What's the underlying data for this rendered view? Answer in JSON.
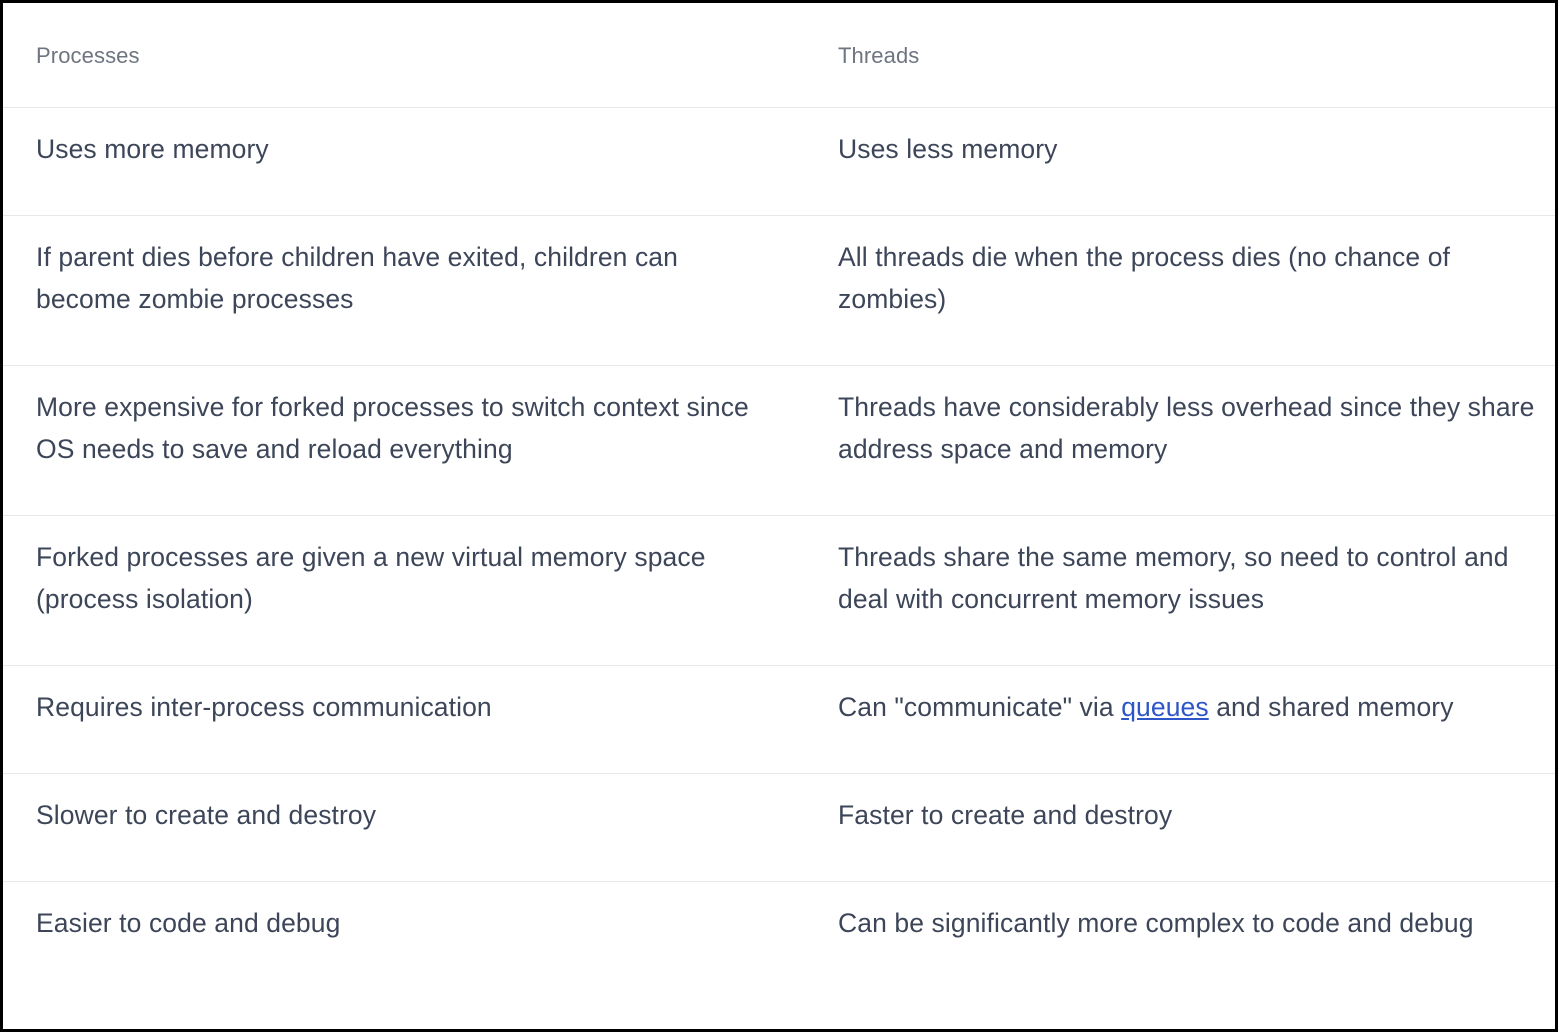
{
  "table": {
    "headers": {
      "left": "Processes",
      "right": "Threads"
    },
    "rows": [
      {
        "left": "Uses more memory",
        "right": "Uses less memory"
      },
      {
        "left": "If parent dies before children have exited, children can become zombie processes",
        "right": "All threads die when the process dies (no chance of zombies)"
      },
      {
        "left": "More expensive for forked processes to switch context since OS needs to save and reload everything",
        "right": "Threads have considerably less overhead since they share address space and memory"
      },
      {
        "left": "Forked processes are given a new virtual memory space (process isolation)",
        "right": "Threads share the same memory, so need to control and deal with concurrent memory issues"
      },
      {
        "left": "Requires inter-process communication",
        "right_before": "Can \"communicate\" via ",
        "right_link": "queues",
        "right_after": " and shared memory"
      },
      {
        "left": "Slower to create and destroy",
        "right": "Faster to create and destroy"
      },
      {
        "left": "Easier to code and debug",
        "right": "Can be significantly more complex to code and debug"
      }
    ]
  },
  "colors": {
    "text": "#3d4659",
    "header_text": "#6e7480",
    "link": "#2f56c8",
    "divider": "#e6e8eb",
    "frame_border": "#000000"
  }
}
